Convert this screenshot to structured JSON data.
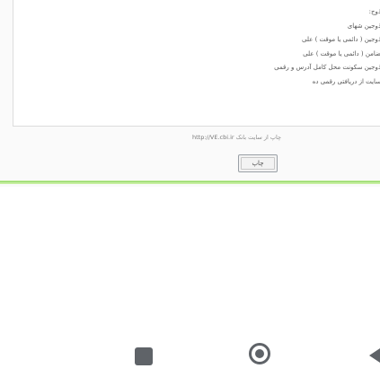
{
  "document": {
    "lines": [
      "ذوج:",
      "ذوجين شهای",
      "ذوجين ( دائمی یا موقت ) علی",
      "ضامن ( دائمی یا موقت ) علی",
      "ذوجين سکونت محل کامل آدرس و رقمی",
      "سایت از دریافتی رقمی ده"
    ]
  },
  "print_source": {
    "label": "چاپ از سایت بانک",
    "url": "http://VE.cbi.ir"
  },
  "print_button": {
    "label": "چاپ"
  },
  "colors": {
    "divider_green": "#c6eea0",
    "nav_icons": "#5f6368"
  },
  "navbar": {
    "recent_icon": "square-recents-icon",
    "home_icon": "circle-home-icon",
    "back_icon": "triangle-back-icon"
  }
}
